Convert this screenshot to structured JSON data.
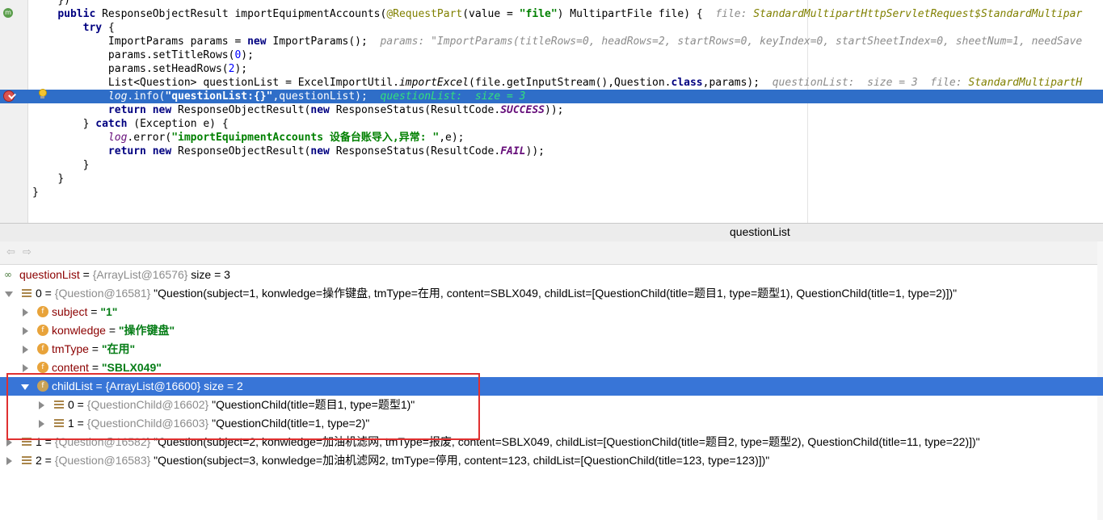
{
  "editor": {
    "lines": [
      {
        "indent": "    ",
        "parts": [
          {
            "t": "})",
            "c": ""
          }
        ]
      },
      {
        "indent": "    ",
        "parts": [
          {
            "t": "public ",
            "c": "kw"
          },
          {
            "t": "ResponseObjectResult importEquipmentAccounts(",
            "c": ""
          },
          {
            "t": "@RequestPart",
            "c": "ann"
          },
          {
            "t": "(value = ",
            "c": ""
          },
          {
            "t": "\"file\"",
            "c": "str"
          },
          {
            "t": ") MultipartFile file) {  ",
            "c": ""
          },
          {
            "t": "file: ",
            "c": "hint"
          },
          {
            "t": "StandardMultipartHttpServletRequest$StandardMultipar",
            "c": "hint-var"
          }
        ]
      },
      {
        "indent": "        ",
        "parts": [
          {
            "t": "try ",
            "c": "kw"
          },
          {
            "t": "{",
            "c": ""
          }
        ]
      },
      {
        "indent": "            ",
        "parts": [
          {
            "t": "ImportParams params = ",
            "c": ""
          },
          {
            "t": "new ",
            "c": "kw"
          },
          {
            "t": "ImportParams();  ",
            "c": ""
          },
          {
            "t": "params: \"ImportParams(titleRows=0, headRows=2, startRows=0, keyIndex=0, startSheetIndex=0, sheetNum=1, needSave",
            "c": "hint"
          }
        ]
      },
      {
        "indent": "            ",
        "parts": [
          {
            "t": "params.setTitleRows(",
            "c": ""
          },
          {
            "t": "0",
            "c": "num"
          },
          {
            "t": ");",
            "c": ""
          }
        ]
      },
      {
        "indent": "            ",
        "parts": [
          {
            "t": "params.setHeadRows(",
            "c": ""
          },
          {
            "t": "2",
            "c": "num"
          },
          {
            "t": ");",
            "c": ""
          }
        ]
      },
      {
        "indent": "            ",
        "parts": [
          {
            "t": "List<Question> questionList = ExcelImportUtil.",
            "c": ""
          },
          {
            "t": "importExcel",
            "c": "sm"
          },
          {
            "t": "(file.getInputStream(),Question.",
            "c": ""
          },
          {
            "t": "class",
            "c": "kw"
          },
          {
            "t": ",params);  ",
            "c": ""
          },
          {
            "t": "questionList:  size = 3  file: ",
            "c": "hint"
          },
          {
            "t": "StandardMultipartH",
            "c": "hint-var"
          }
        ]
      },
      {
        "indent": "            ",
        "hl": true,
        "parts": [
          {
            "t": "log",
            "c": "ital"
          },
          {
            "t": ".info(",
            "c": ""
          },
          {
            "t": "\"questionList:{}\"",
            "c": "strw"
          },
          {
            "t": ",questionList);  ",
            "c": ""
          },
          {
            "t": "questionList:  size = 3",
            "c": "hint-green"
          }
        ]
      },
      {
        "indent": "            ",
        "parts": [
          {
            "t": "return new ",
            "c": "kw"
          },
          {
            "t": "ResponseObjectResult(",
            "c": ""
          },
          {
            "t": "new ",
            "c": "kw"
          },
          {
            "t": "ResponseStatus(ResultCode.",
            "c": ""
          },
          {
            "t": "SUCCESS",
            "c": "const"
          },
          {
            "t": "));",
            "c": ""
          }
        ]
      },
      {
        "indent": "        ",
        "parts": [
          {
            "t": "} ",
            "c": ""
          },
          {
            "t": "catch ",
            "c": "kw"
          },
          {
            "t": "(Exception e) {",
            "c": ""
          }
        ]
      },
      {
        "indent": "            ",
        "parts": [
          {
            "t": "log",
            "c": "ital"
          },
          {
            "t": ".error(",
            "c": ""
          },
          {
            "t": "\"importEquipmentAccounts 设备台账导入,异常: \"",
            "c": "str"
          },
          {
            "t": ",e);",
            "c": ""
          }
        ]
      },
      {
        "indent": "            ",
        "parts": [
          {
            "t": "return new ",
            "c": "kw"
          },
          {
            "t": "ResponseObjectResult(",
            "c": ""
          },
          {
            "t": "new ",
            "c": "kw"
          },
          {
            "t": "ResponseStatus(ResultCode.",
            "c": ""
          },
          {
            "t": "FAIL",
            "c": "const"
          },
          {
            "t": "));",
            "c": ""
          }
        ]
      },
      {
        "indent": "        ",
        "parts": [
          {
            "t": "}",
            "c": ""
          }
        ]
      },
      {
        "indent": "    ",
        "parts": [
          {
            "t": "}",
            "c": ""
          }
        ]
      },
      {
        "indent": "",
        "parts": [
          {
            "t": "}",
            "c": ""
          }
        ]
      }
    ]
  },
  "panel": {
    "title": "questionList",
    "nav_back": "⇦",
    "nav_forward": "⇨"
  },
  "tree": {
    "root": {
      "name": "questionList",
      "eq": " = ",
      "ref": "{ArrayList@16576}",
      "extra": "  size = 3"
    },
    "item0": {
      "name": "0",
      "eq": " = ",
      "ref": "{Question@16581}",
      "value": " \"Question(subject=1, konwledge=操作键盘, tmType=在用, content=SBLX049, childList=[QuestionChild(title=题目1, type=题型1), QuestionChild(title=1, type=2)])\""
    },
    "fields": [
      {
        "name": "subject",
        "eq": " = ",
        "value": "\"1\""
      },
      {
        "name": "konwledge",
        "eq": " = ",
        "value": "\"操作键盘\""
      },
      {
        "name": "tmType",
        "eq": " = ",
        "value": "\"在用\""
      },
      {
        "name": "content",
        "eq": " = ",
        "value": "\"SBLX049\""
      }
    ],
    "childList": {
      "name": "childList",
      "eq": " = ",
      "ref": "{ArrayList@16600}",
      "extra": "  size = 2"
    },
    "children": [
      {
        "name": "0",
        "eq": " = ",
        "ref": "{QuestionChild@16602}",
        "value": " \"QuestionChild(title=题目1, type=题型1)\""
      },
      {
        "name": "1",
        "eq": " = ",
        "ref": "{QuestionChild@16603}",
        "value": " \"QuestionChild(title=1, type=2)\""
      }
    ],
    "item1": {
      "name": "1",
      "eq": " = ",
      "ref": "{Question@16582}",
      "value": " \"Question(subject=2, konwledge=加油机滤网, tmType=报废, content=SBLX049, childList=[QuestionChild(title=题目2, type=题型2), QuestionChild(title=11, type=22)])\""
    },
    "item2": {
      "name": "2",
      "eq": " = ",
      "ref": "{Question@16583}",
      "value": " \"Question(subject=3, konwledge=加油机滤网2, tmType=停用, content=123, childList=[QuestionChild(title=123, type=123)])\""
    },
    "field_icon_letter": "f",
    "watch_icon": "∞"
  }
}
